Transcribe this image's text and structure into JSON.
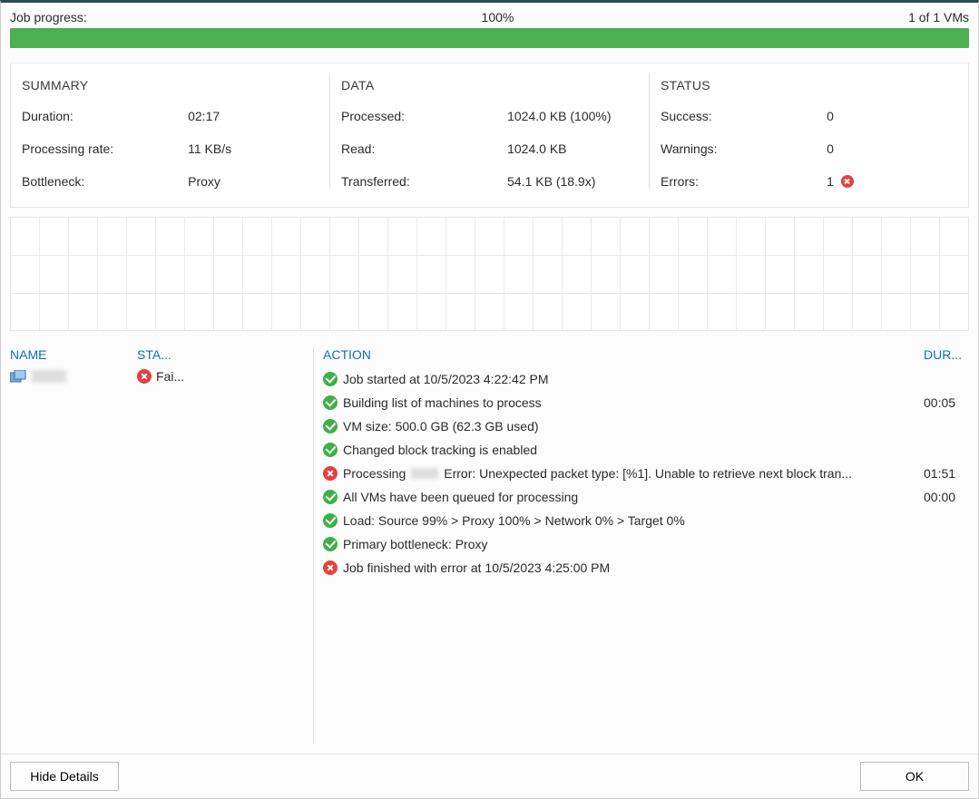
{
  "progress": {
    "label": "Job progress:",
    "percent_text": "100%",
    "count_text": "1 of 1 VMs",
    "percent_value": 100
  },
  "summary": {
    "title": "SUMMARY",
    "rows": [
      {
        "label": "Duration:",
        "value": "02:17"
      },
      {
        "label": "Processing rate:",
        "value": "11 KB/s"
      },
      {
        "label": "Bottleneck:",
        "value": "Proxy"
      }
    ]
  },
  "data": {
    "title": "DATA",
    "rows": [
      {
        "label": "Processed:",
        "value": "1024.0 KB (100%)"
      },
      {
        "label": "Read:",
        "value": "1024.0 KB"
      },
      {
        "label": "Transferred:",
        "value": "54.1 KB (18.9x)"
      }
    ]
  },
  "status": {
    "title": "STATUS",
    "rows": [
      {
        "label": "Success:",
        "value": "0",
        "icon": ""
      },
      {
        "label": "Warnings:",
        "value": "0",
        "icon": ""
      },
      {
        "label": "Errors:",
        "value": "1",
        "icon": "error"
      }
    ]
  },
  "vm_headers": {
    "name": "NAME",
    "status": "STA..."
  },
  "action_headers": {
    "action": "ACTION",
    "duration": "DUR..."
  },
  "vms": [
    {
      "status_text": "Fai..."
    }
  ],
  "actions": [
    {
      "icon": "success",
      "text": "Job started at 10/5/2023 4:22:42 PM",
      "duration": ""
    },
    {
      "icon": "success",
      "text": "Building list of machines to process",
      "duration": "00:05"
    },
    {
      "icon": "success",
      "text": "VM size: 500.0 GB (62.3 GB used)",
      "duration": ""
    },
    {
      "icon": "success",
      "text": "Changed block tracking is enabled",
      "duration": ""
    },
    {
      "icon": "error",
      "text_pre": "Processing ",
      "blur": true,
      "text_post": " Error: Unexpected packet type: [%1]. Unable to retrieve next block tran...",
      "duration": "01:51"
    },
    {
      "icon": "success",
      "text": "All VMs have been queued for processing",
      "duration": "00:00"
    },
    {
      "icon": "success",
      "text": "Load: Source 99% > Proxy 100% > Network 0% > Target 0%",
      "duration": ""
    },
    {
      "icon": "success",
      "text": "Primary bottleneck: Proxy",
      "duration": ""
    },
    {
      "icon": "error",
      "text": "Job finished with error at 10/5/2023 4:25:00 PM",
      "duration": ""
    }
  ],
  "buttons": {
    "hide_details": "Hide Details",
    "ok": "OK"
  }
}
